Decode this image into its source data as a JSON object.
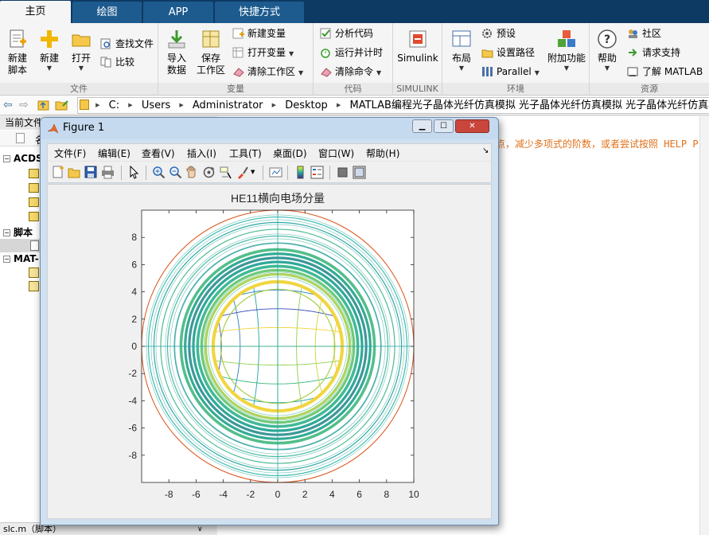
{
  "ribbon": {
    "tabs": [
      "主页",
      "绘图",
      "APP",
      "快捷方式"
    ],
    "file": {
      "label": "文件",
      "new_script": [
        "新建",
        "脚本"
      ],
      "new": "新建",
      "open": "打开",
      "find_files": "查找文件",
      "compare": "比较"
    },
    "variable": {
      "label": "变量",
      "import": [
        "导入",
        "数据"
      ],
      "save_ws": [
        "保存",
        "工作区"
      ],
      "new_var": "新建变量",
      "open_var": "打开变量",
      "clear_ws": "清除工作区"
    },
    "code": {
      "label": "代码",
      "analyze": "分析代码",
      "run_time": "运行并计时",
      "clear_cmd": "清除命令"
    },
    "simulink": {
      "label": "SIMULINK",
      "btn": "Simulink"
    },
    "env": {
      "label": "环境",
      "layout": "布局",
      "prefs": "预设",
      "set_path": "设置路径",
      "parallel": "Parallel",
      "addons": "附加功能"
    },
    "resources": {
      "label": "资源",
      "help": "帮助",
      "community": "社区",
      "support": "请求支持",
      "learn": "了解 MATLAB"
    }
  },
  "address": {
    "crumbs": [
      "C:",
      "Users",
      "Administrator",
      "Desktop",
      "MATLAB编程光子晶体光纤仿真模拟 光子晶体光纤仿真模拟 光子晶体光纤仿真模拟源码程序"
    ]
  },
  "current_folder": {
    "header": "当前文件",
    "col_name": "名",
    "groups": [
      "ACDS",
      "脚本",
      "MAT-"
    ]
  },
  "details": {
    "file": "slc.m（脚本）"
  },
  "command_window": {
    "message": "点，减少多项式的阶数，或者尝试按照 HELP P"
  },
  "figure": {
    "title": "Figure 1",
    "menus": [
      "文件(F)",
      "编辑(E)",
      "查看(V)",
      "插入(I)",
      "工具(T)",
      "桌面(D)",
      "窗口(W)",
      "帮助(H)"
    ],
    "toolbar_icons": [
      "new-figure-icon",
      "open-file-icon",
      "save-icon",
      "print-icon",
      "pointer-icon",
      "zoom-in-icon",
      "zoom-out-icon",
      "pan-icon",
      "rotate-3d-icon",
      "data-cursor-icon",
      "brush-icon",
      "link-plot-icon",
      "colorbar-icon",
      "legend-icon",
      "hide-plot-tools-icon",
      "show-plot-tools-icon"
    ]
  },
  "colors": {
    "tab_bar": "#0d3a63",
    "tab_inactive": "#1d5b8f",
    "orange_message": "#e0701a",
    "outer_circle": "#d95319"
  },
  "chart_data": {
    "type": "contour",
    "title": "HE11横向电场分量",
    "xlabel": "",
    "ylabel": "",
    "xlim": [
      -10,
      10
    ],
    "ylim": [
      -10,
      10
    ],
    "xticks": [
      -8,
      -6,
      -4,
      -2,
      0,
      2,
      4,
      6,
      8,
      10
    ],
    "yticks": [
      -8,
      -6,
      -4,
      -2,
      0,
      2,
      4,
      6,
      8
    ],
    "grid": false,
    "colormap": "parula",
    "boundary_circle_radius": 10,
    "ring_radii": [
      4.8,
      5.3,
      5.6,
      5.9,
      6.2,
      6.5,
      6.8,
      7.1,
      7.6,
      8.1,
      8.6,
      9.1,
      9.5
    ],
    "ring_colors": [
      "#f0d43a",
      "#a5cf4b",
      "#5ec369",
      "#2bb28a",
      "#1a9e8f",
      "#2a8a8e",
      "#1fa28a",
      "#40b87a",
      "#2ba0a0",
      "#3ab39a",
      "#52c08a",
      "#1a9d9a",
      "#26b3a8"
    ],
    "core_levels": [
      -0.9,
      -0.6,
      -0.3,
      0,
      0.3,
      0.6,
      0.9
    ]
  }
}
